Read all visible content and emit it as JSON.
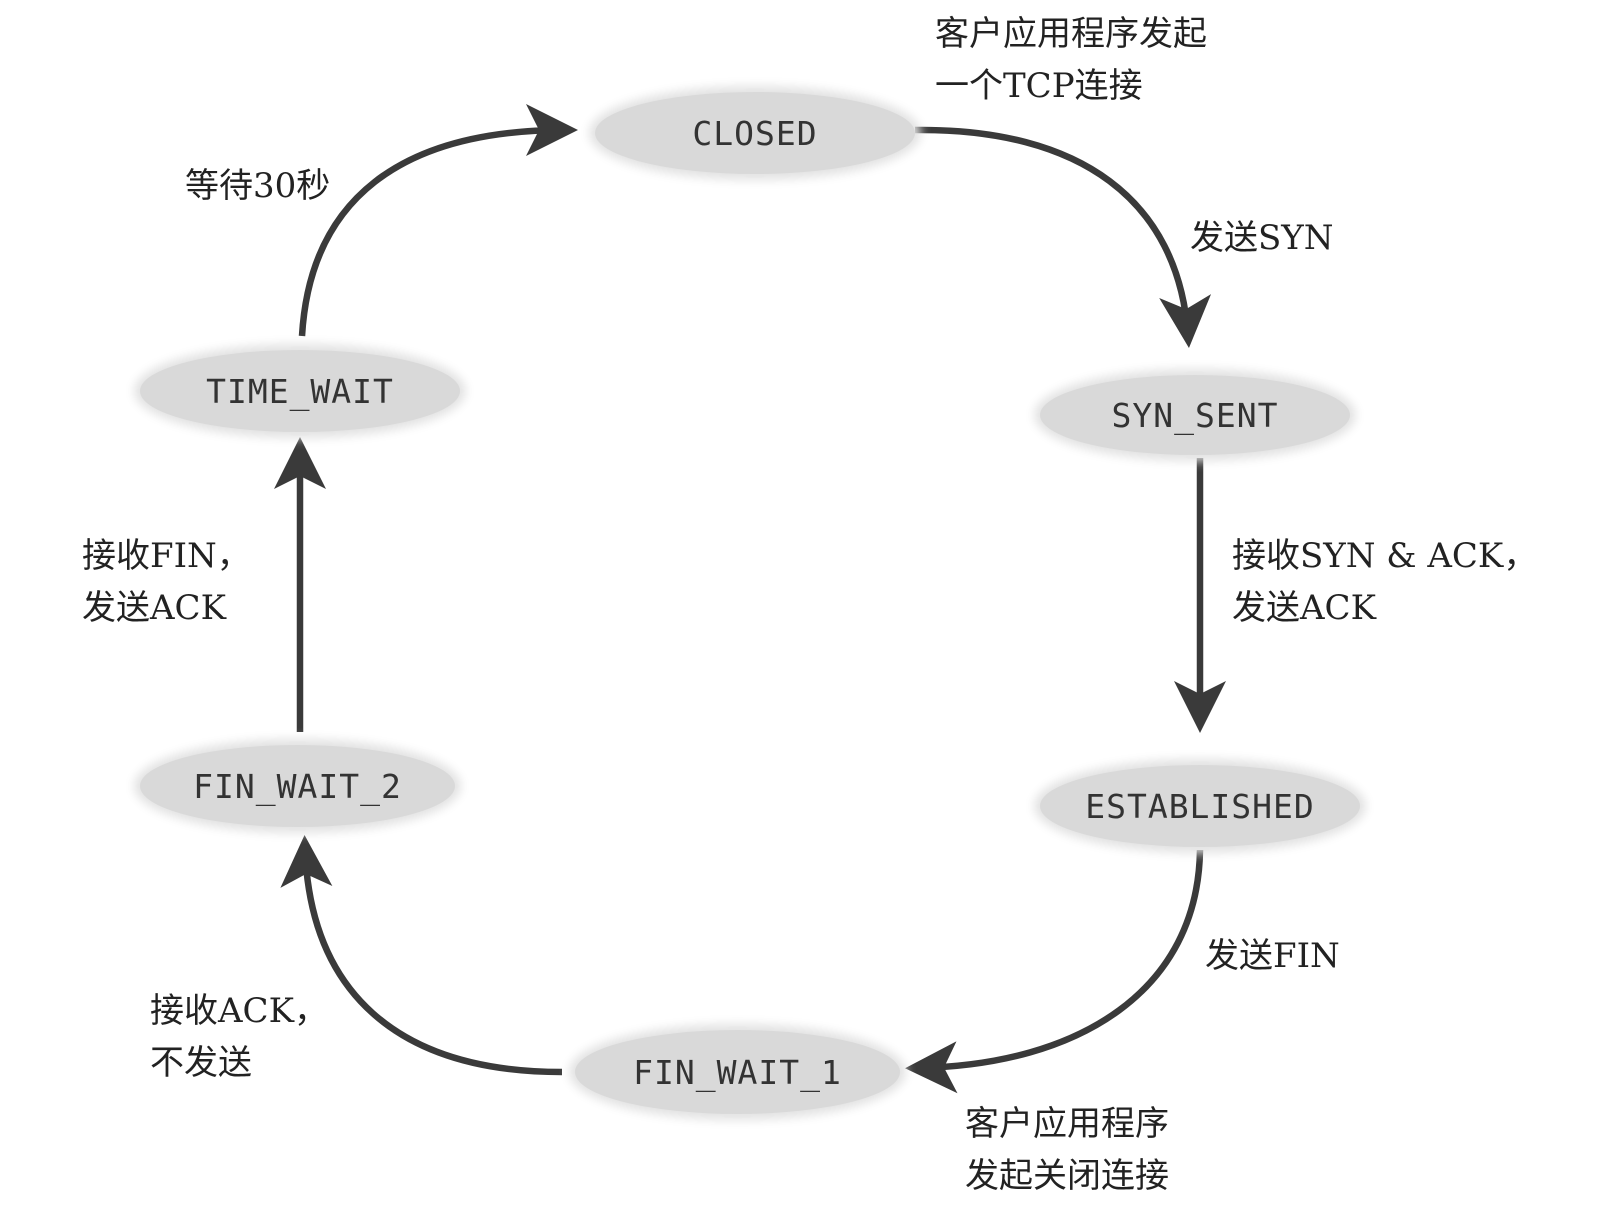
{
  "colors": {
    "edge": "#3a3a3a",
    "state_fill": "#d9d9d9",
    "text": "#222222"
  },
  "states": {
    "closed": "CLOSED",
    "syn_sent": "SYN_SENT",
    "established": "ESTABLISHED",
    "fin_wait_1": "FIN_WAIT_1",
    "fin_wait_2": "FIN_WAIT_2",
    "time_wait": "TIME_WAIT"
  },
  "transitions": {
    "client_initiates_tcp": [
      "客户应用程序发起",
      "一个TCP连接"
    ],
    "send_syn": [
      "发送SYN"
    ],
    "receive_syn_ack_send_ack": [
      "接收SYN & ACK，",
      "发送ACK"
    ],
    "send_fin": [
      "发送FIN"
    ],
    "client_initiates_close": [
      "客户应用程序",
      "发起关闭连接"
    ],
    "receive_ack_send_nothing": [
      "接收ACK，",
      "不发送"
    ],
    "receive_fin_send_ack": [
      "接收FIN，",
      "发送ACK"
    ],
    "wait_30_seconds": [
      "等待30秒"
    ]
  }
}
